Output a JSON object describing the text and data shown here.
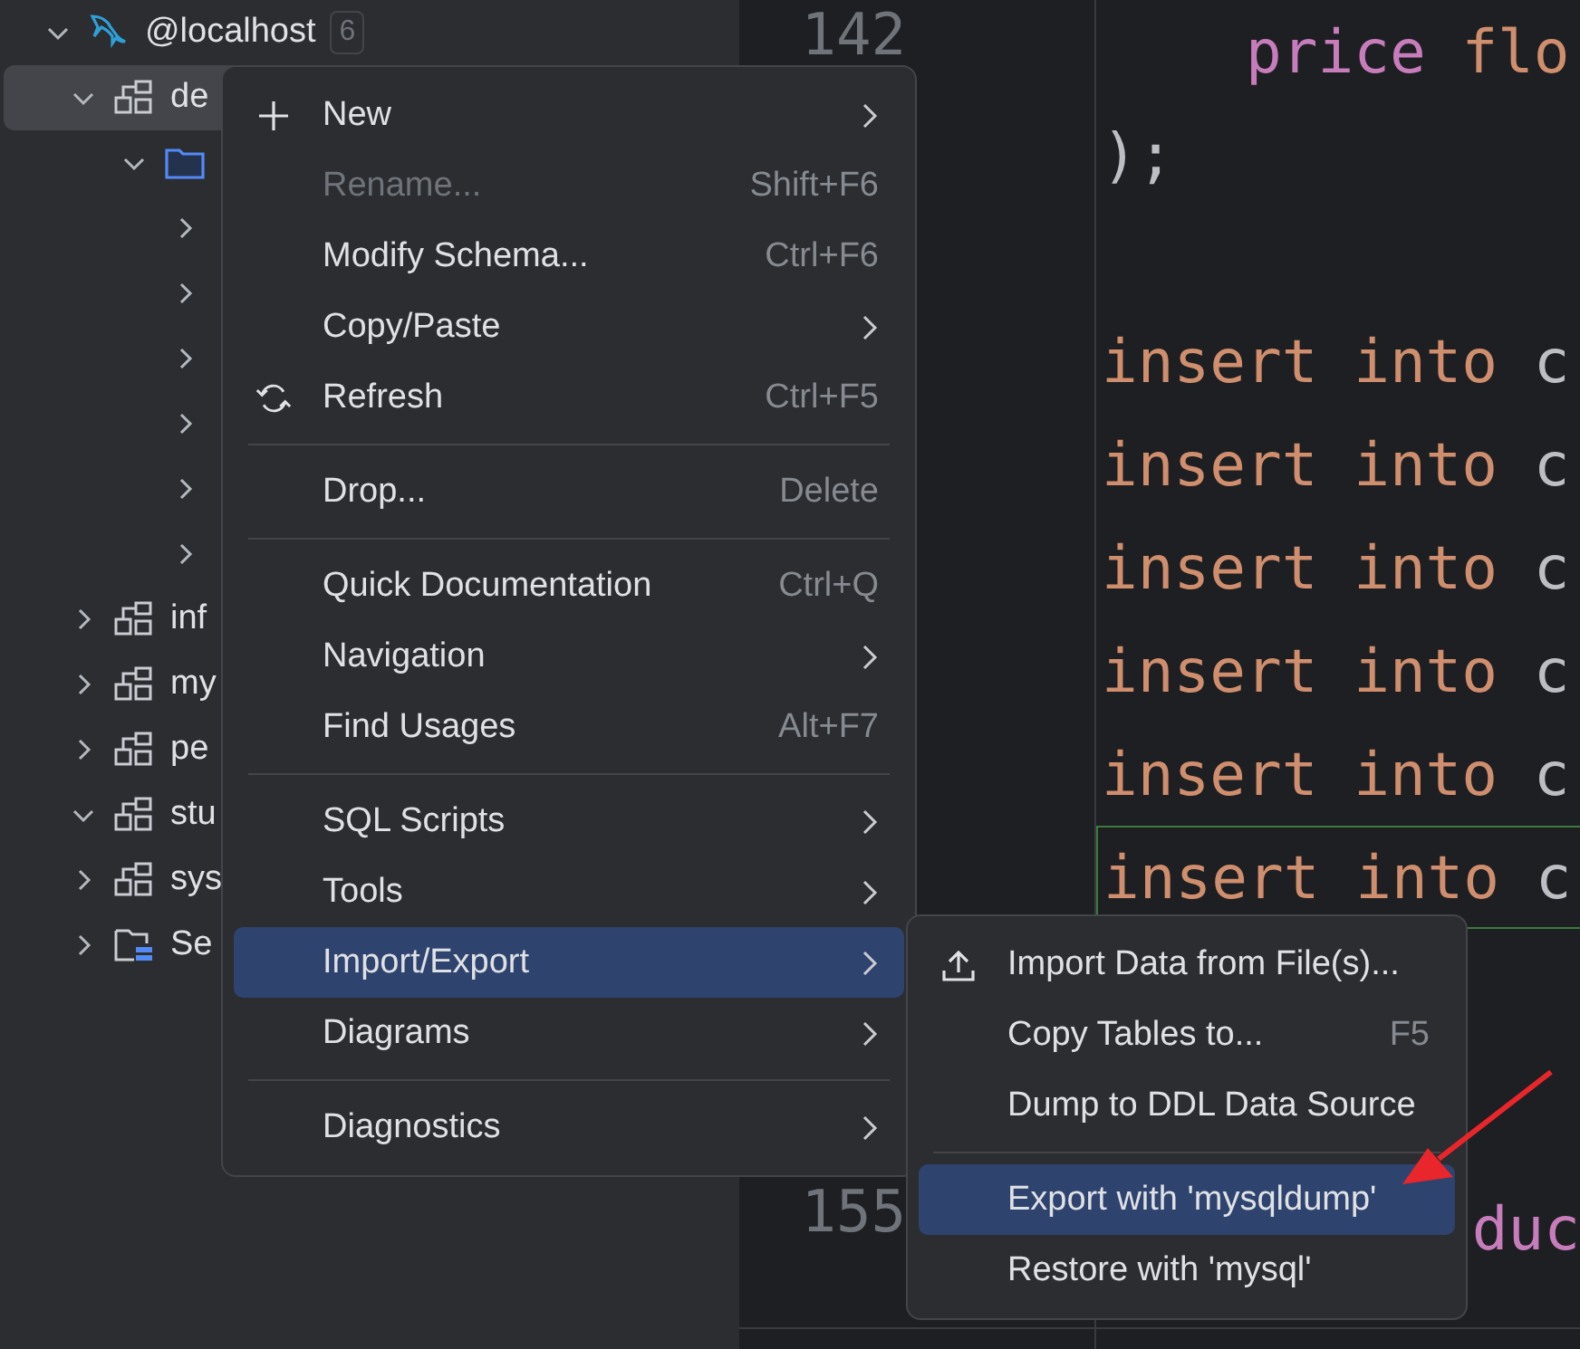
{
  "tree": {
    "root": {
      "label": "@localhost",
      "count": "6",
      "expanded": true
    },
    "items": [
      {
        "label": "de",
        "kind": "schema",
        "expanded": true,
        "selected": true,
        "children": [
          {
            "kind": "folder",
            "expanded": true,
            "children": [
              {
                "expanded": false
              },
              {
                "expanded": false
              },
              {
                "expanded": false
              },
              {
                "expanded": false
              },
              {
                "expanded": false
              },
              {
                "expanded": false
              }
            ]
          }
        ]
      },
      {
        "label": "inf",
        "kind": "schema",
        "expanded": false,
        "selected": false
      },
      {
        "label": "my",
        "kind": "schema",
        "expanded": false,
        "selected": false
      },
      {
        "label": "pe",
        "kind": "schema",
        "expanded": false,
        "selected": false
      },
      {
        "label": "stu",
        "kind": "schema",
        "expanded": true,
        "selected": false
      },
      {
        "label": "sys",
        "kind": "schema",
        "expanded": false,
        "selected": false
      },
      {
        "label": "Se",
        "kind": "server",
        "expanded": false,
        "selected": false
      }
    ]
  },
  "editor": {
    "lines": [
      {
        "number": "142",
        "tokens": [
          {
            "text": "    price ",
            "kind": "field"
          },
          {
            "text": "flo",
            "kind": "keyword"
          }
        ]
      },
      {
        "tokens": [
          {
            "text": ");",
            "kind": "plain"
          }
        ]
      },
      {
        "blank": true
      },
      {
        "tokens": [
          {
            "text": "insert into ",
            "kind": "keyword"
          },
          {
            "text": "c",
            "kind": "plain"
          }
        ]
      },
      {
        "tokens": [
          {
            "text": "insert into ",
            "kind": "keyword"
          },
          {
            "text": "c",
            "kind": "plain"
          }
        ]
      },
      {
        "tokens": [
          {
            "text": "insert into ",
            "kind": "keyword"
          },
          {
            "text": "c",
            "kind": "plain"
          }
        ]
      },
      {
        "tokens": [
          {
            "text": "insert into ",
            "kind": "keyword"
          },
          {
            "text": "c",
            "kind": "plain"
          }
        ]
      },
      {
        "tokens": [
          {
            "text": "insert into ",
            "kind": "keyword"
          },
          {
            "text": "c",
            "kind": "plain"
          }
        ]
      },
      {
        "tokens": [
          {
            "text": "insert into ",
            "kind": "keyword"
          },
          {
            "text": "c",
            "kind": "plain"
          }
        ],
        "current": true
      },
      {
        "blank": true
      },
      {
        "blank": true
      },
      {
        "number": "155",
        "covered": true,
        "tokens": [
          {
            "text": "duc",
            "kind": "field"
          }
        ]
      }
    ]
  },
  "context_menu": {
    "groups": [
      [
        {
          "label": "New",
          "submenu": true,
          "disabled": false,
          "selected": false
        },
        {
          "label": "Rename...",
          "shortcut": "Shift+F6",
          "disabled": true,
          "selected": false
        },
        {
          "label": "Modify Schema...",
          "shortcut": "Ctrl+F6",
          "disabled": false,
          "selected": false
        },
        {
          "label": "Copy/Paste",
          "submenu": true,
          "disabled": false,
          "selected": false
        },
        {
          "label": "Refresh",
          "shortcut": "Ctrl+F5",
          "disabled": false,
          "selected": false
        }
      ],
      [
        {
          "label": "Drop...",
          "shortcut": "Delete",
          "disabled": false,
          "selected": false
        }
      ],
      [
        {
          "label": "Quick Documentation",
          "shortcut": "Ctrl+Q",
          "disabled": false,
          "selected": false
        },
        {
          "label": "Navigation",
          "submenu": true,
          "disabled": false,
          "selected": false
        },
        {
          "label": "Find Usages",
          "shortcut": "Alt+F7",
          "disabled": false,
          "selected": false
        }
      ],
      [
        {
          "label": "SQL Scripts",
          "submenu": true,
          "disabled": false,
          "selected": false
        },
        {
          "label": "Tools",
          "submenu": true,
          "disabled": false,
          "selected": false
        },
        {
          "label": "Import/Export",
          "submenu": true,
          "disabled": false,
          "selected": true
        },
        {
          "label": "Diagrams",
          "submenu": true,
          "disabled": false,
          "selected": false
        }
      ],
      [
        {
          "label": "Diagnostics",
          "submenu": true,
          "disabled": false,
          "selected": false
        }
      ]
    ]
  },
  "submenu": {
    "groups": [
      [
        {
          "label": "Import Data from File(s)...",
          "disabled": false,
          "selected": false
        },
        {
          "label": "Copy Tables to...",
          "shortcut": "F5",
          "disabled": false,
          "selected": false
        },
        {
          "label": "Dump to DDL Data Source",
          "disabled": false,
          "selected": false
        }
      ],
      [
        {
          "label": "Export with 'mysqldump'",
          "disabled": false,
          "selected": true
        },
        {
          "label": "Restore with 'mysql'",
          "disabled": false,
          "selected": false
        }
      ]
    ]
  }
}
